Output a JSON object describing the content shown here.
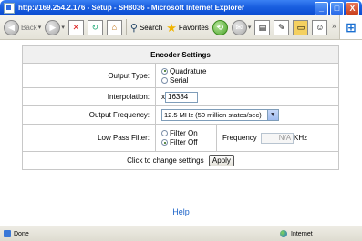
{
  "window": {
    "title": "http://169.254.2.176 - Setup - SH8036 - Microsoft Internet Explorer",
    "minimize_label": "_",
    "maximize_label": "□",
    "close_label": "X"
  },
  "toolbar": {
    "back_label": "Back",
    "search_label": "Search",
    "favorites_label": "Favorites"
  },
  "form": {
    "header": "Encoder Settings",
    "output_type": {
      "label": "Output Type:",
      "options": [
        "Quadrature",
        "Serial"
      ],
      "selected": "Quadrature"
    },
    "interpolation": {
      "label": "Interpolation:",
      "prefix": "x",
      "value": "16384"
    },
    "output_frequency": {
      "label": "Output Frequency:",
      "value": "12.5 MHz (50 million states/sec)"
    },
    "low_pass_filter": {
      "label": "Low Pass Filter:",
      "options": [
        "Filter On",
        "Filter Off"
      ],
      "selected": "Filter Off",
      "frequency_label": "Frequency",
      "frequency_value": "N/A",
      "frequency_unit": "KHz"
    },
    "apply_text": "Click to change settings",
    "apply_label": "Apply"
  },
  "help_link": "Help",
  "status": {
    "left": "Done",
    "zone": "Internet"
  }
}
